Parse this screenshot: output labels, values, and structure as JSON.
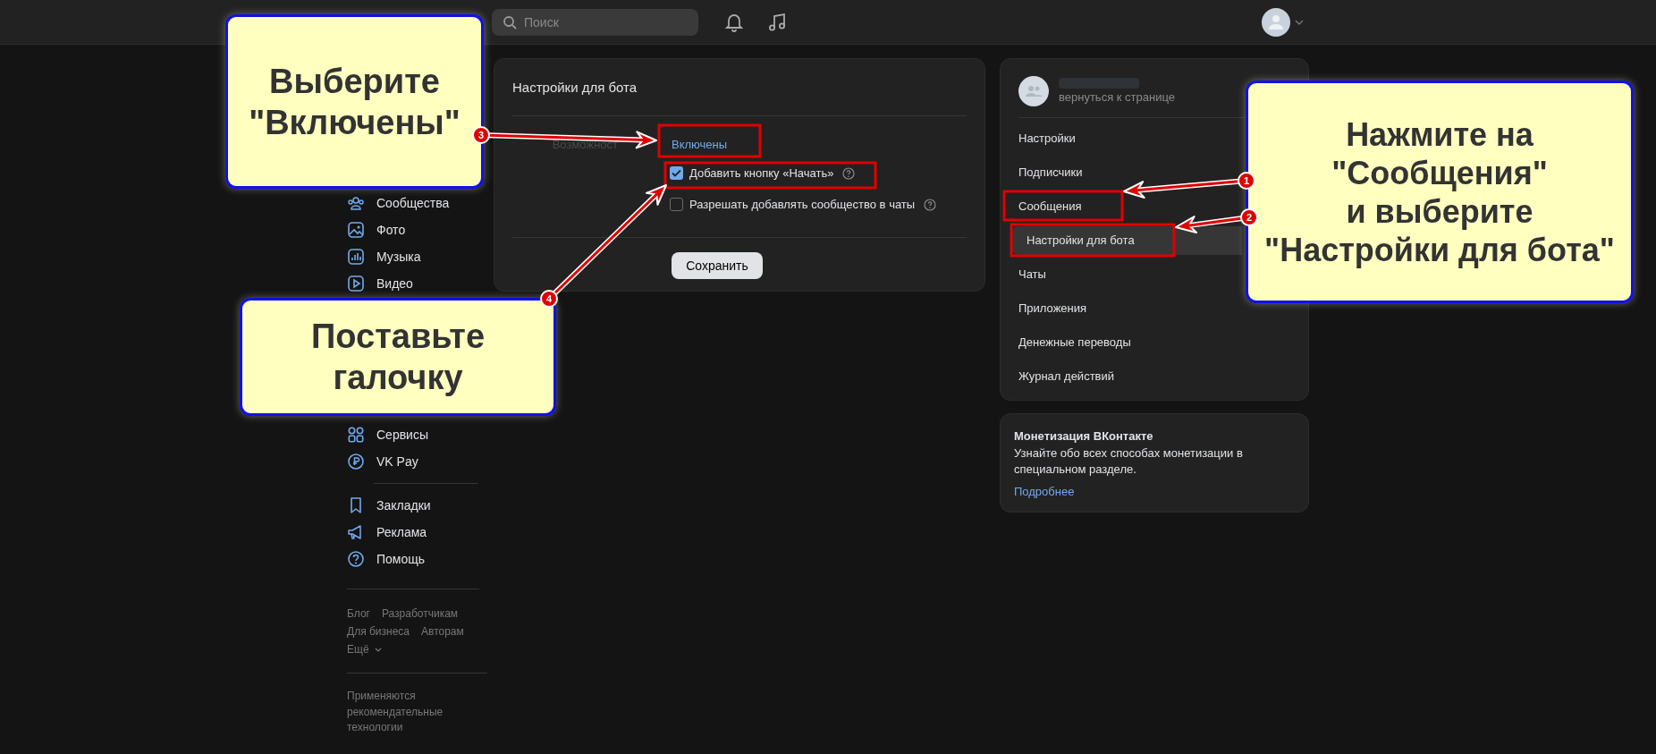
{
  "top_bar": {
    "search": {
      "placeholder": "Поиск"
    }
  },
  "left_nav": {
    "groups": [
      [
        {
          "label": "Сообщества",
          "kind": "people"
        },
        {
          "label": "Фото",
          "kind": "photo"
        },
        {
          "label": "Музыка",
          "kind": "music"
        },
        {
          "label": "Видео",
          "kind": "video"
        }
      ],
      [
        {
          "label": "Сервисы",
          "kind": "grid"
        },
        {
          "label": "VK Pay",
          "kind": "pay"
        }
      ],
      [
        {
          "label": "Закладки",
          "kind": "bookmark"
        },
        {
          "label": "Реклама",
          "kind": "megaphone"
        },
        {
          "label": "Помощь",
          "kind": "help"
        }
      ]
    ],
    "footer_links": [
      [
        "Блог",
        "Разработчикам"
      ],
      [
        "Для бизнеса",
        "Авторам"
      ]
    ],
    "more": "Ещё",
    "note": "Применяются рекомендательные технологии"
  },
  "settings_card": {
    "title": "Настройки для бота",
    "field_label": "Возможност",
    "status_link": "Включены",
    "options": [
      {
        "label": "Добавить кнопку «Начать»",
        "checked": true
      },
      {
        "label": "Разрешать добавлять сообщество в чаты",
        "checked": false
      }
    ],
    "save_button": "Сохранить"
  },
  "community_menu": {
    "back_link": "вернуться к странице",
    "items": [
      {
        "label": "Настройки",
        "selected": false
      },
      {
        "label": "Подписчики",
        "selected": false
      },
      {
        "label": "Сообщения",
        "selected": false,
        "children": [
          {
            "label": "Настройки для бота",
            "selected": true
          }
        ]
      },
      {
        "label": "Чаты",
        "selected": false
      },
      {
        "label": "Приложения",
        "selected": false
      },
      {
        "label": "Денежные переводы",
        "selected": false
      },
      {
        "label": "Журнал действий",
        "selected": false
      }
    ]
  },
  "monetization_card": {
    "title": "Монетизация ВКонтакте",
    "text": "Узнайте обо всех способах монетизации в специальном разделе.",
    "link": "Подробнее"
  },
  "callouts": [
    {
      "text": "Выберите\n\"Включены\""
    },
    {
      "text": "Поставьте\nгалочку"
    },
    {
      "text": "Нажмите на\n\"Сообщения\"\nи выберите\n\"Настройки для бота\""
    }
  ],
  "markers": [
    "1",
    "2",
    "3",
    "4"
  ]
}
